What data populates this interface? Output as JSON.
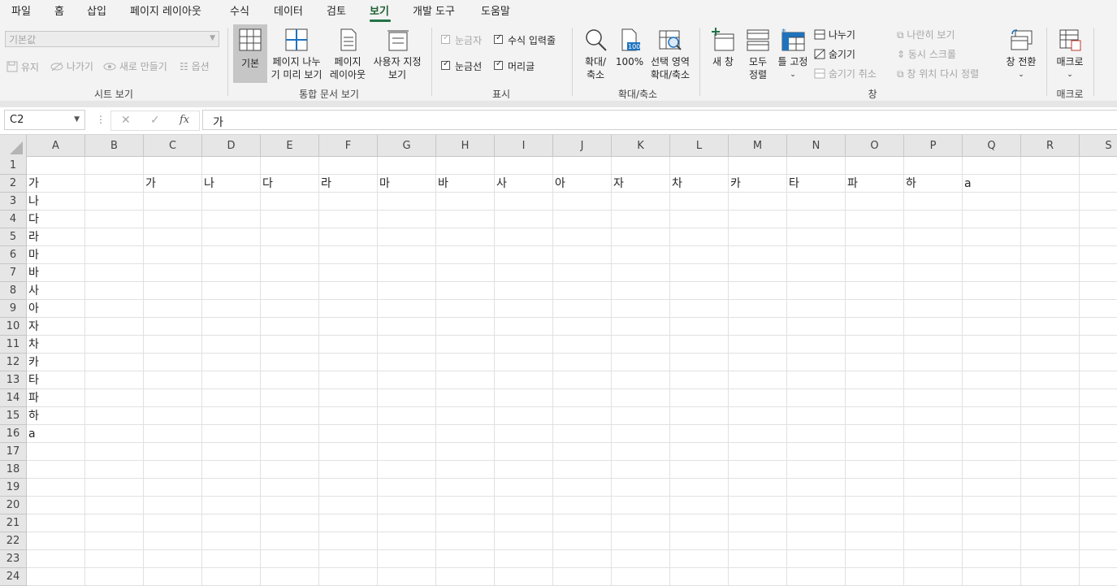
{
  "menu": {
    "tabs": [
      "파일",
      "홈",
      "삽입",
      "페이지 레이아웃",
      "수식",
      "데이터",
      "검토",
      "보기",
      "개발 도구",
      "도움말"
    ],
    "active": "보기"
  },
  "ribbon": {
    "sheet_view": {
      "combo_value": "기본값",
      "keep": "유지",
      "exit": "나가기",
      "new": "새로 만들기",
      "options": "옵션",
      "label": "시트 보기"
    },
    "workbook_views": {
      "normal": "기본",
      "page_break_1": "페이지 나누",
      "page_break_2": "기 미리 보기",
      "page_layout_1": "페이지",
      "page_layout_2": "레이아웃",
      "custom_1": "사용자 지정",
      "custom_2": "보기",
      "label": "통합 문서 보기"
    },
    "show": {
      "ruler": "눈금자",
      "formula_bar": "수식 입력줄",
      "gridlines": "눈금선",
      "headings": "머리글",
      "label": "표시"
    },
    "zoom": {
      "zoom_1": "확대/",
      "zoom_2": "축소",
      "hundred": "100%",
      "selection_1": "선택 영역",
      "selection_2": "확대/축소",
      "label": "확대/축소"
    },
    "window": {
      "new_window": "새 창",
      "arrange_1": "모두",
      "arrange_2": "정렬",
      "freeze": "틀 고정",
      "split": "나누기",
      "hide": "숨기기",
      "unhide": "숨기기 취소",
      "side_by_side": "나란히 보기",
      "sync_scroll": "동시 스크롤",
      "reset_position": "창 위치 다시 정렬",
      "switch": "창 전환",
      "label": "창"
    },
    "macros": {
      "macro": "매크로",
      "label": "매크로"
    }
  },
  "formula_bar": {
    "name_box": "C2",
    "formula": "가"
  },
  "sheet": {
    "columns": [
      "A",
      "B",
      "C",
      "D",
      "E",
      "F",
      "G",
      "H",
      "I",
      "J",
      "K",
      "L",
      "M",
      "N",
      "O",
      "P",
      "Q",
      "R",
      "S"
    ],
    "rows": [
      "1",
      "2",
      "3",
      "4",
      "5",
      "6",
      "7",
      "8",
      "9",
      "10",
      "11",
      "12",
      "13",
      "14",
      "15",
      "16",
      "17",
      "18",
      "19",
      "20",
      "21",
      "22",
      "23",
      "24"
    ],
    "row2": [
      "가",
      "",
      "가",
      "나",
      "다",
      "라",
      "마",
      "바",
      "사",
      "아",
      "자",
      "차",
      "카",
      "타",
      "파",
      "하",
      "a",
      "",
      ""
    ],
    "colA": [
      "",
      "가",
      "나",
      "다",
      "라",
      "마",
      "바",
      "사",
      "아",
      "자",
      "차",
      "카",
      "타",
      "파",
      "하",
      "a",
      "",
      "",
      "",
      "",
      "",
      "",
      "",
      ""
    ]
  },
  "colors": {
    "accent": "#217346",
    "selected_blue": "#1e73be"
  }
}
